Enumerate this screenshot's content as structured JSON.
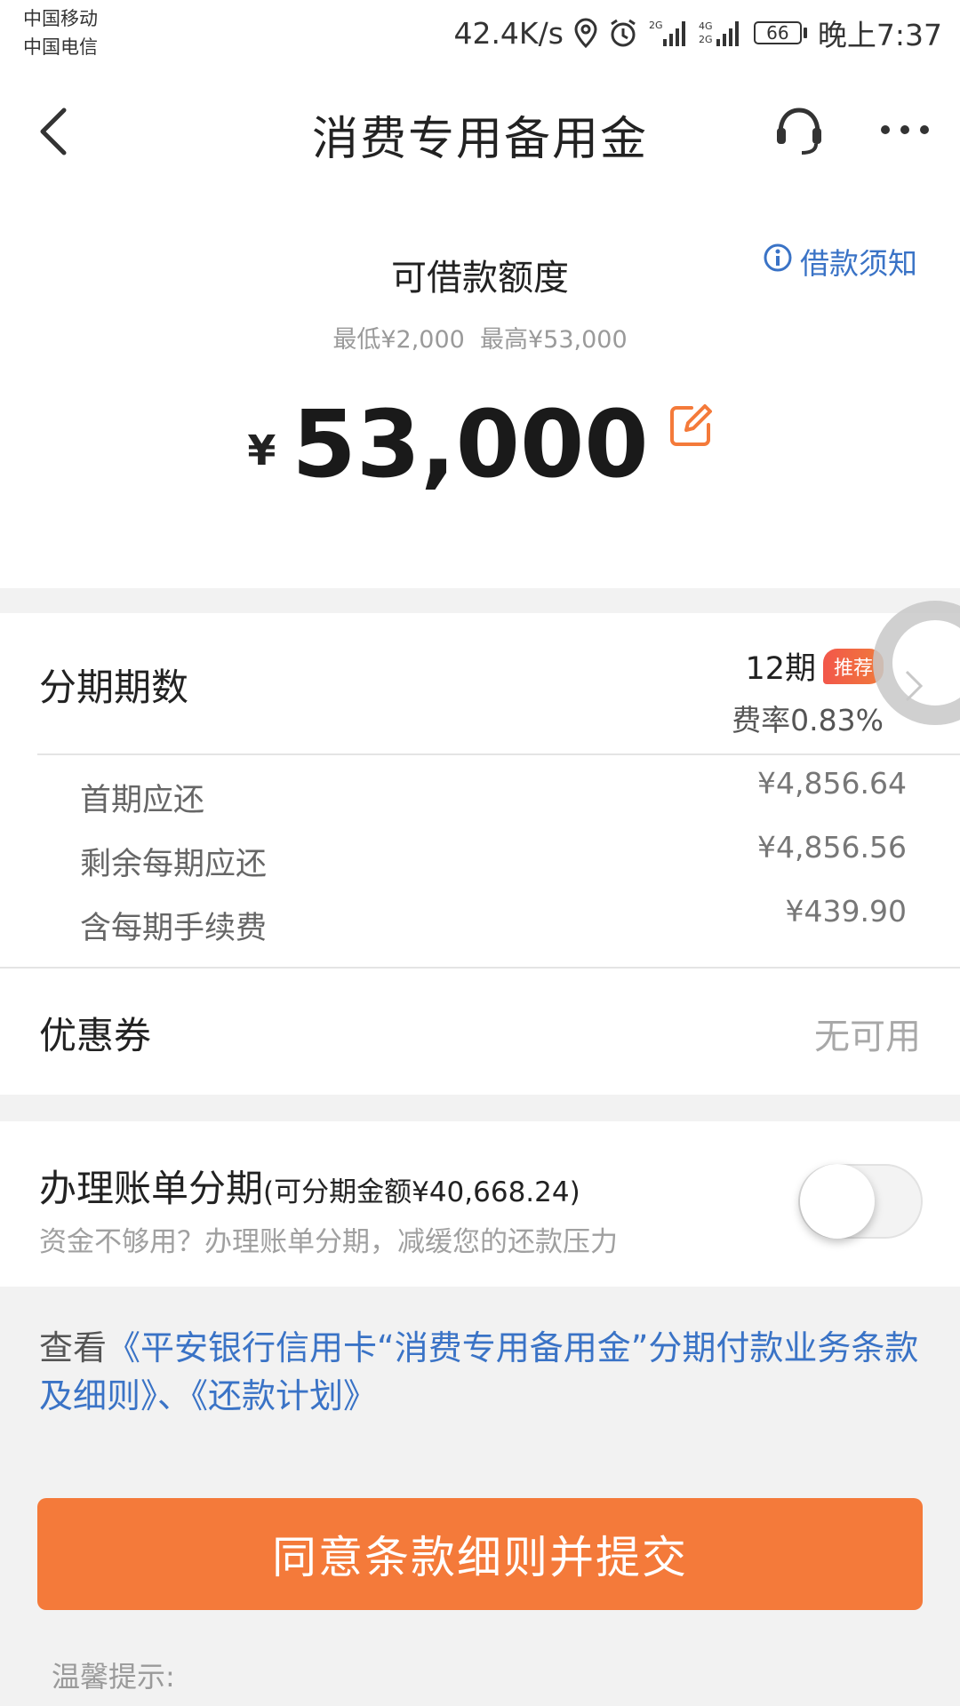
{
  "status_bar": {
    "carrier_1": "中国移动",
    "carrier_2": "中国电信",
    "speed": "42.4K/s",
    "battery": "66",
    "time": "晚上7:37"
  },
  "navbar": {
    "title": "消费专用备用金"
  },
  "loan": {
    "label": "可借款额度",
    "notice_link": "借款须知",
    "range_min": "最低¥2,000",
    "range_max": "最高¥53,000",
    "currency": "¥",
    "amount": "53,000"
  },
  "installment": {
    "title": "分期期数",
    "period": "12期",
    "tag": "推荐",
    "rate": "费率0.83%",
    "details": [
      {
        "label": "首期应还",
        "value": "¥4,856.64"
      },
      {
        "label": "剩余每期应还",
        "value": "¥4,856.56"
      },
      {
        "label": "含每期手续费",
        "value": "¥439.90"
      }
    ]
  },
  "coupon": {
    "title": "优惠券",
    "value": "无可用"
  },
  "bill_installment": {
    "title": "办理账单分期",
    "amount_note": "(可分期金额¥40,668.24)",
    "subtitle": "资金不够用？办理账单分期，减缓您的还款压力",
    "enabled": false
  },
  "terms": {
    "prefix": "查看",
    "link1": "《平安银行信用卡“消费专用备用金”分期付款业务条款及细则》",
    "separator": "、",
    "link2": "《还款计划》"
  },
  "submit_label": "同意条款细则并提交",
  "tips_label": "温馨提示:",
  "colors": {
    "accent": "#f47a3a",
    "link": "#3a73c6",
    "tag": "#f2574a"
  }
}
